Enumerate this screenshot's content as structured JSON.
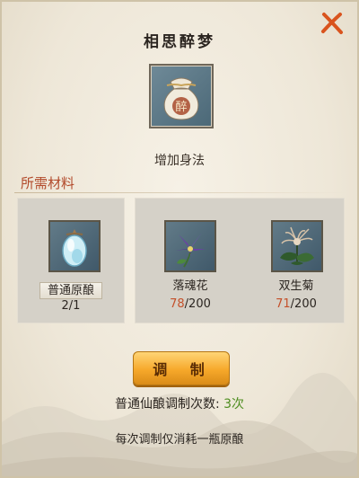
{
  "dialog": {
    "title": "相思醉梦",
    "close_icon": "close-x-icon",
    "accent_color": "#d9541e"
  },
  "result_item": {
    "icon": "wine-pouch-icon",
    "glyph": "醉",
    "effect": "增加身法"
  },
  "materials_section": {
    "title": "所需材料",
    "title_color": "#b24a2b",
    "base": {
      "icon": "crystal-gourd-icon",
      "name": "普通原酿",
      "count": "2/1"
    },
    "items": [
      {
        "icon": "purple-flower-icon",
        "name": "落魂花",
        "have": "78",
        "need": "/200"
      },
      {
        "icon": "chrysanthemum-icon",
        "name": "双生菊",
        "have": "71",
        "need": "/200"
      }
    ],
    "shortage_color": "#c4502a"
  },
  "craft": {
    "button_label": "调 制",
    "count_label": "普通仙酿调制次数:",
    "count_value": "3次",
    "count_color": "#4d8d1f",
    "note": "每次调制仅消耗一瓶原酿"
  }
}
